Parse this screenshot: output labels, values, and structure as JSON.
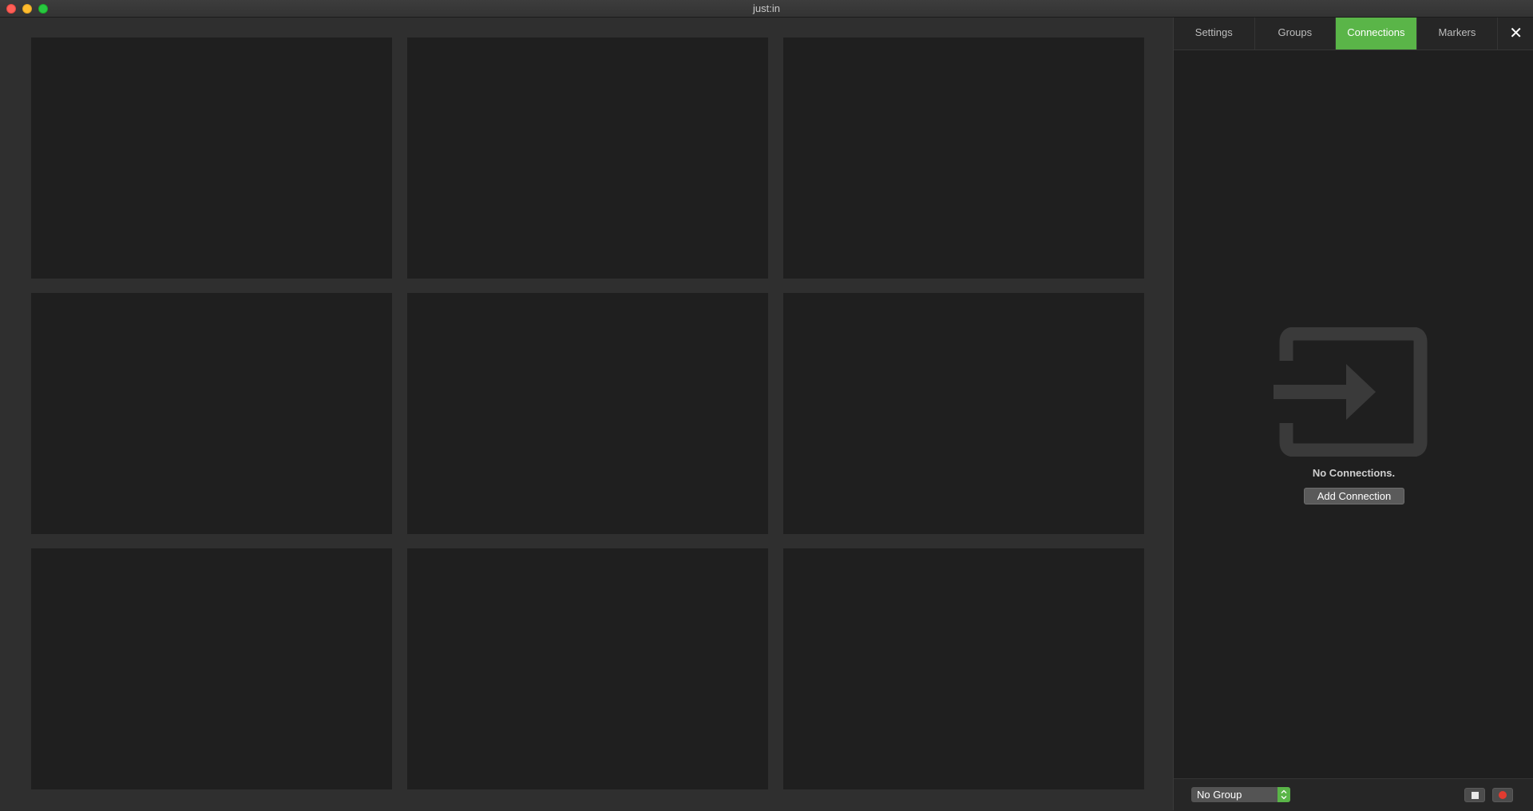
{
  "window": {
    "title": "just:in"
  },
  "grid": {
    "tiles": [
      {
        "id": "tile-1"
      },
      {
        "id": "tile-2"
      },
      {
        "id": "tile-3"
      },
      {
        "id": "tile-4"
      },
      {
        "id": "tile-5"
      },
      {
        "id": "tile-6"
      },
      {
        "id": "tile-7"
      },
      {
        "id": "tile-8"
      },
      {
        "id": "tile-9"
      }
    ]
  },
  "sidebar": {
    "tabs": [
      {
        "label": "Settings",
        "active": false
      },
      {
        "label": "Groups",
        "active": false
      },
      {
        "label": "Connections",
        "active": true
      },
      {
        "label": "Markers",
        "active": false
      }
    ],
    "close_glyph": "✕",
    "empty_state": {
      "icon": "input-arrow-icon",
      "message": "No Connections.",
      "button_label": "Add Connection"
    },
    "footer": {
      "group_select": {
        "value": "No Group"
      },
      "stop_icon": "stop-icon",
      "record_icon": "record-icon"
    }
  },
  "colors": {
    "accent": "#5ab548",
    "record": "#e23b30",
    "tile_bg": "#1f1f1f",
    "gutter_bg": "#2f2f2f"
  }
}
